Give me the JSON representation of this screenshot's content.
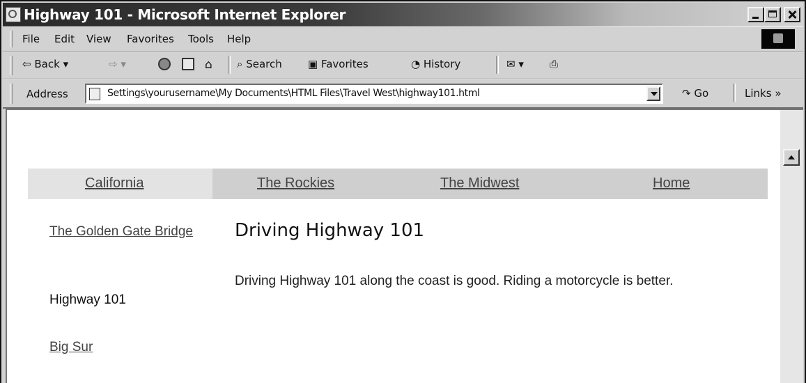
{
  "window": {
    "title": "Highway 101 - Microsoft Internet Explorer"
  },
  "menubar": {
    "items": [
      "File",
      "Edit",
      "View",
      "Favorites",
      "Tools",
      "Help"
    ]
  },
  "toolbar": {
    "back_label": "Back",
    "search_label": "Search",
    "favorites_label": "Favorites",
    "history_label": "History"
  },
  "addressbar": {
    "label": "Address",
    "value": "Settings\\yourusername\\My Documents\\HTML Files\\Travel West\\highway101.html",
    "go_label": "Go",
    "links_label": "Links",
    "chevron": "»"
  },
  "page": {
    "nav": [
      "California",
      "The Rockies",
      "The Midwest",
      "Home"
    ],
    "sidebar": {
      "link1": "The Golden Gate Bridge",
      "current": "Highway 101",
      "link2": "Big Sur"
    },
    "heading": "Driving Highway 101",
    "paragraph": "Driving Highway 101 along the coast is good. Riding a motorcycle is better."
  }
}
